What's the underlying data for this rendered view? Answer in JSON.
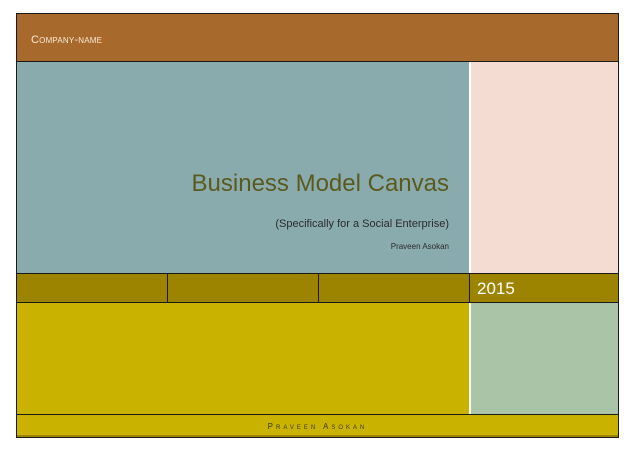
{
  "header": {
    "company": "Company-name"
  },
  "cover": {
    "title": "Business Model Canvas",
    "subtitle": "(Specifically for a Social Enterprise)",
    "author": "Praveen Asokan"
  },
  "band": {
    "year": "2015"
  },
  "footer": {
    "author": "Praveen Asokan"
  },
  "colors": {
    "header": "#a8692d",
    "teal": "#8aabad",
    "pink": "#f4dcd3",
    "band": "#9c8300",
    "yellow": "#c9b200",
    "green": "#aac4a8"
  }
}
